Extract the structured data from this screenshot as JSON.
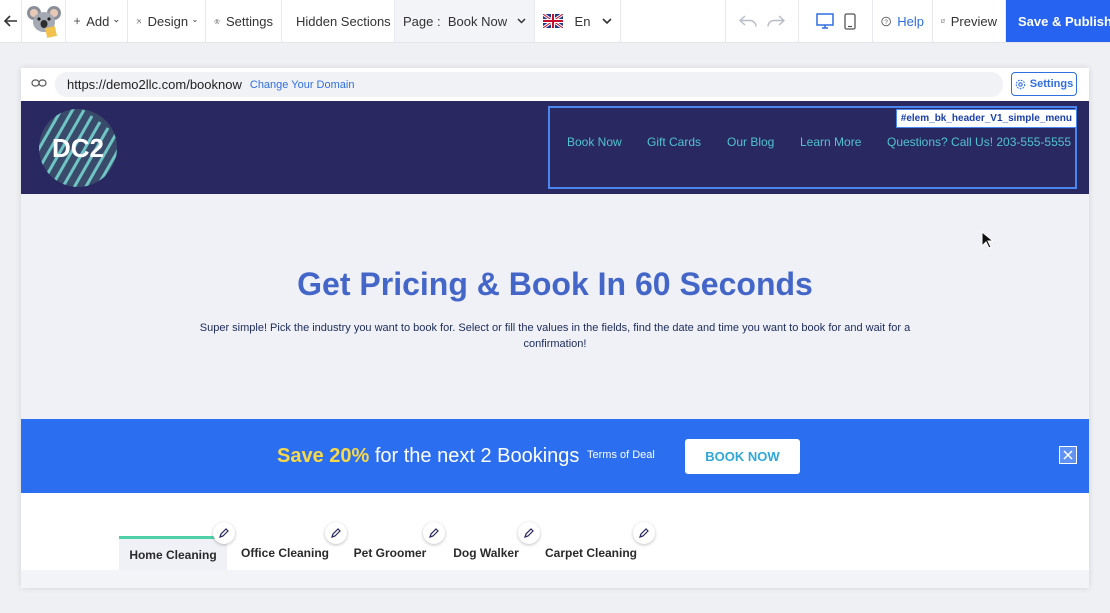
{
  "toolbar": {
    "add_label": "Add",
    "design_label": "Design",
    "settings_label": "Settings",
    "hidden_sections_label": "Hidden Sections",
    "page_prefix": "Page :",
    "page_value": "Book Now",
    "language": "En",
    "help_label": "Help",
    "preview_label": "Preview",
    "publish_label": "Save & Publish",
    "accent": "#2563f0"
  },
  "frame": {
    "url": "https://demo2llc.com/booknow",
    "change_domain": "Change Your Domain",
    "settings_label": "Settings"
  },
  "site": {
    "logo_text": "DC2",
    "selected_element_tag": "#elem_bk_header_V1_simple_menu",
    "menu": [
      "Book Now",
      "Gift Cards",
      "Our Blog",
      "Learn More",
      "Questions? Call Us! 203-555-5555"
    ],
    "header_bg": "#2a2860"
  },
  "hero": {
    "title": "Get Pricing & Book In 60 Seconds",
    "subtitle": "Super simple! Pick the industry you want to book for. Select or fill the values in the fields, find the date and time you want to book for and wait for a confirmation!"
  },
  "promo": {
    "highlight": "Save 20%",
    "rest": " for the next 2 Bookings",
    "terms": "Terms of Deal",
    "cta": "BOOK NOW",
    "bg": "#2b6ef0"
  },
  "tabs": [
    "Home Cleaning",
    "Office Cleaning",
    "Pet Groomer",
    "Dog Walker",
    "Carpet Cleaning"
  ],
  "active_tab": "Home Cleaning"
}
